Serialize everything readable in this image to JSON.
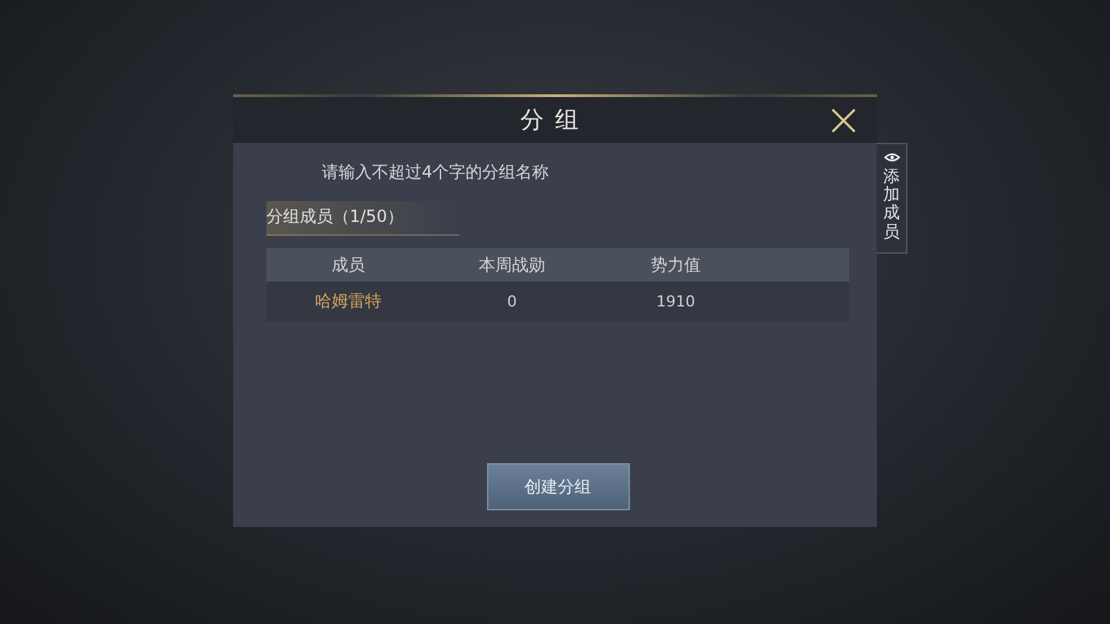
{
  "dialog": {
    "title": "分组",
    "name_field": {
      "placeholder": "请输入不超过4个字的分组名称"
    },
    "members_label": "分组成员（1/50）",
    "table": {
      "columns": [
        "成员",
        "本周战勋",
        "势力值"
      ],
      "rows": [
        {
          "cells": [
            "哈姆雷特",
            "0",
            "1910"
          ]
        }
      ]
    },
    "create_button": "创建分组"
  },
  "side_tab": {
    "label": "添加成员"
  }
}
